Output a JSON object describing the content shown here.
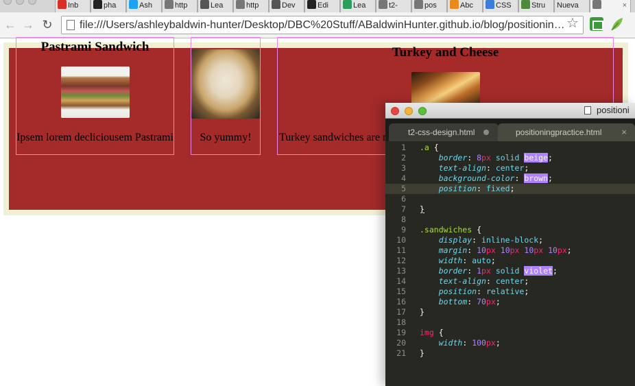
{
  "browser": {
    "tabs": [
      {
        "label": "Inb",
        "icon": "gmail-icon",
        "color": "#d93025"
      },
      {
        "label": "pha",
        "icon": "github-icon",
        "color": "#222222"
      },
      {
        "label": "Ash",
        "icon": "twitter-icon",
        "color": "#1da1f2"
      },
      {
        "label": "http",
        "icon": "page-icon",
        "color": "#777777"
      },
      {
        "label": "Lea",
        "icon": "code-icon",
        "color": "#555555"
      },
      {
        "label": "http",
        "icon": "page-icon",
        "color": "#777777"
      },
      {
        "label": "Dev",
        "icon": "code-icon",
        "color": "#555555"
      },
      {
        "label": "Edi",
        "icon": "github-icon",
        "color": "#222222"
      },
      {
        "label": "Lea",
        "icon": "rainbow-icon",
        "color": "#2e9c5a"
      },
      {
        "label": "t2-",
        "icon": "page-icon",
        "color": "#777777"
      },
      {
        "label": "pos",
        "icon": "page-icon",
        "color": "#777777"
      },
      {
        "label": "Abc",
        "icon": "asterisk-icon",
        "color": "#e8891c"
      },
      {
        "label": "CSS",
        "icon": "globe-icon",
        "color": "#3b7dd8"
      },
      {
        "label": "Stru",
        "icon": "map-icon",
        "color": "#4b8b3b"
      },
      {
        "label": "Nueva",
        "icon": "none",
        "color": "#e2e2e2"
      },
      {
        "label": "",
        "icon": "page-icon",
        "color": "#777777"
      }
    ],
    "url": "file:///Users/ashleybaldwin-hunter/Desktop/DBC%20Stuff/ABaldwinHunter.github.io/blog/positionin…"
  },
  "page": {
    "sandwiches": [
      {
        "title": "Pastrami Sandwich",
        "caption": "Ipsem lorem decliciousem Pastrami"
      },
      {
        "title": "",
        "caption": "So yummy!"
      },
      {
        "title": "Turkey and Cheese",
        "caption": "Turkey sandwiches are n"
      }
    ]
  },
  "editor": {
    "title": "positioni",
    "tabs": [
      {
        "label": "t2-css-design.html",
        "modified": true
      },
      {
        "label": "positioningpractice.html",
        "modified": false
      }
    ],
    "current_line": 5,
    "lines": [
      [
        {
          "c": "t-sel",
          "t": ".a"
        },
        {
          "c": "t-punct",
          "t": " {"
        }
      ],
      [
        {
          "c": "t-punct",
          "t": "    "
        },
        {
          "c": "t-prop",
          "t": "border"
        },
        {
          "c": "t-punct",
          "t": ": "
        },
        {
          "c": "t-num",
          "t": "8"
        },
        {
          "c": "t-unit",
          "t": "px"
        },
        {
          "c": "t-punct",
          "t": " "
        },
        {
          "c": "t-val",
          "t": "solid"
        },
        {
          "c": "t-punct",
          "t": " "
        },
        {
          "c": "t-hl",
          "t": "beige"
        },
        {
          "c": "t-punct",
          "t": ";"
        }
      ],
      [
        {
          "c": "t-punct",
          "t": "    "
        },
        {
          "c": "t-prop",
          "t": "text-align"
        },
        {
          "c": "t-punct",
          "t": ": "
        },
        {
          "c": "t-val",
          "t": "center"
        },
        {
          "c": "t-punct",
          "t": ";"
        }
      ],
      [
        {
          "c": "t-punct",
          "t": "    "
        },
        {
          "c": "t-prop",
          "t": "background-color"
        },
        {
          "c": "t-punct",
          "t": ": "
        },
        {
          "c": "t-hl",
          "t": "brown"
        },
        {
          "c": "t-punct",
          "t": ";"
        }
      ],
      [
        {
          "c": "t-punct",
          "t": "    "
        },
        {
          "c": "t-prop",
          "t": "position"
        },
        {
          "c": "t-punct",
          "t": ": "
        },
        {
          "c": "t-val",
          "t": "fixed"
        },
        {
          "c": "t-punct",
          "t": ";"
        }
      ],
      [],
      [
        {
          "c": "t-brace-u",
          "t": "}"
        }
      ],
      [],
      [
        {
          "c": "t-sel",
          "t": ".sandwiches"
        },
        {
          "c": "t-punct",
          "t": " {"
        }
      ],
      [
        {
          "c": "t-punct",
          "t": "    "
        },
        {
          "c": "t-prop",
          "t": "display"
        },
        {
          "c": "t-punct",
          "t": ": "
        },
        {
          "c": "t-val",
          "t": "inline-block"
        },
        {
          "c": "t-punct",
          "t": ";"
        }
      ],
      [
        {
          "c": "t-punct",
          "t": "    "
        },
        {
          "c": "t-prop",
          "t": "margin"
        },
        {
          "c": "t-punct",
          "t": ": "
        },
        {
          "c": "t-num",
          "t": "10"
        },
        {
          "c": "t-unit",
          "t": "px"
        },
        {
          "c": "t-punct",
          "t": " "
        },
        {
          "c": "t-num",
          "t": "10"
        },
        {
          "c": "t-unit",
          "t": "px"
        },
        {
          "c": "t-punct",
          "t": " "
        },
        {
          "c": "t-num",
          "t": "10"
        },
        {
          "c": "t-unit",
          "t": "px"
        },
        {
          "c": "t-punct",
          "t": " "
        },
        {
          "c": "t-num",
          "t": "10"
        },
        {
          "c": "t-unit",
          "t": "px"
        },
        {
          "c": "t-punct",
          "t": ";"
        }
      ],
      [
        {
          "c": "t-punct",
          "t": "    "
        },
        {
          "c": "t-prop",
          "t": "width"
        },
        {
          "c": "t-punct",
          "t": ": "
        },
        {
          "c": "t-val",
          "t": "auto"
        },
        {
          "c": "t-punct",
          "t": ";"
        }
      ],
      [
        {
          "c": "t-punct",
          "t": "    "
        },
        {
          "c": "t-prop",
          "t": "border"
        },
        {
          "c": "t-punct",
          "t": ": "
        },
        {
          "c": "t-num",
          "t": "1"
        },
        {
          "c": "t-unit",
          "t": "px"
        },
        {
          "c": "t-punct",
          "t": " "
        },
        {
          "c": "t-val",
          "t": "solid"
        },
        {
          "c": "t-punct",
          "t": " "
        },
        {
          "c": "t-hl",
          "t": "violet"
        },
        {
          "c": "t-punct",
          "t": ";"
        }
      ],
      [
        {
          "c": "t-punct",
          "t": "    "
        },
        {
          "c": "t-prop",
          "t": "text-align"
        },
        {
          "c": "t-punct",
          "t": ": "
        },
        {
          "c": "t-val",
          "t": "center"
        },
        {
          "c": "t-punct",
          "t": ";"
        }
      ],
      [
        {
          "c": "t-punct",
          "t": "    "
        },
        {
          "c": "t-prop",
          "t": "position"
        },
        {
          "c": "t-punct",
          "t": ": "
        },
        {
          "c": "t-val",
          "t": "relative"
        },
        {
          "c": "t-punct",
          "t": ";"
        }
      ],
      [
        {
          "c": "t-punct",
          "t": "    "
        },
        {
          "c": "t-prop",
          "t": "bottom"
        },
        {
          "c": "t-punct",
          "t": ": "
        },
        {
          "c": "t-num",
          "t": "70"
        },
        {
          "c": "t-unit",
          "t": "px"
        },
        {
          "c": "t-punct",
          "t": ";"
        }
      ],
      [
        {
          "c": "t-brace",
          "t": "}"
        }
      ],
      [],
      [
        {
          "c": "t-tag",
          "t": "img"
        },
        {
          "c": "t-punct",
          "t": " {"
        }
      ],
      [
        {
          "c": "t-punct",
          "t": "    "
        },
        {
          "c": "t-prop",
          "t": "width"
        },
        {
          "c": "t-punct",
          "t": ": "
        },
        {
          "c": "t-num",
          "t": "100"
        },
        {
          "c": "t-unit",
          "t": "px"
        },
        {
          "c": "t-punct",
          "t": ";"
        }
      ],
      [
        {
          "c": "t-brace",
          "t": "}"
        }
      ]
    ]
  }
}
